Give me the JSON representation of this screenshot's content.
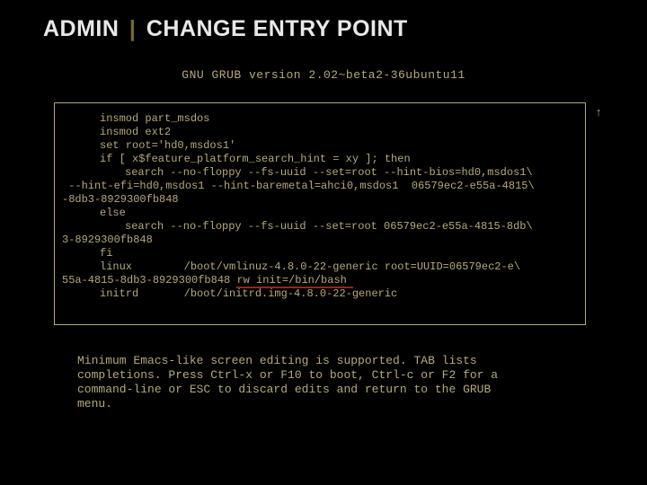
{
  "heading": {
    "prefix": "ADMIN",
    "sep": "|",
    "title": "CHANGE ENTRY POINT"
  },
  "grub": {
    "version": "GNU GRUB  version 2.02~beta2-36ubuntu11"
  },
  "editor": {
    "lines": [
      {
        "cls": "indent1",
        "text": "insmod part_msdos"
      },
      {
        "cls": "indent1",
        "text": "insmod ext2"
      },
      {
        "cls": "indent1",
        "text": "set root='hd0,msdos1'"
      },
      {
        "cls": "indent1",
        "text": "if [ x$feature_platform_search_hint = xy ]; then"
      },
      {
        "cls": "indent2",
        "text": "search --no-floppy --fs-uuid --set=root --hint-bios=hd0,msdos1\\"
      },
      {
        "cls": "cont",
        "text": " --hint-efi=hd0,msdos1 --hint-baremetal=ahci0,msdos1  06579ec2-e55a-4815\\"
      },
      {
        "cls": "cont",
        "text": "-8db3-8929300fb848"
      },
      {
        "cls": "indent1",
        "text": "else"
      },
      {
        "cls": "indent2",
        "text": "search --no-floppy --fs-uuid --set=root 06579ec2-e55a-4815-8db\\"
      },
      {
        "cls": "cont",
        "text": "3-8929300fb848"
      },
      {
        "cls": "indent1",
        "text": "fi"
      },
      {
        "cls": "indent1",
        "text": "linux        /boot/vmlinuz-4.8.0-22-generic root=UUID=06579ec2-e\\"
      },
      {
        "cls": "cont",
        "text": "55a-4815-8db3-8929300fb848 ",
        "underlined": "rw init=/bin/bash "
      },
      {
        "cls": "indent1",
        "text": "initrd       /boot/initrd.img-4.8.0-22-generic"
      }
    ],
    "scroll_arrow": "↑"
  },
  "help": {
    "text": "Minimum Emacs-like screen editing is supported. TAB lists\ncompletions. Press Ctrl-x or F10 to boot, Ctrl-c or F2 for a\ncommand-line or ESC to discard edits and return to the GRUB\nmenu."
  }
}
